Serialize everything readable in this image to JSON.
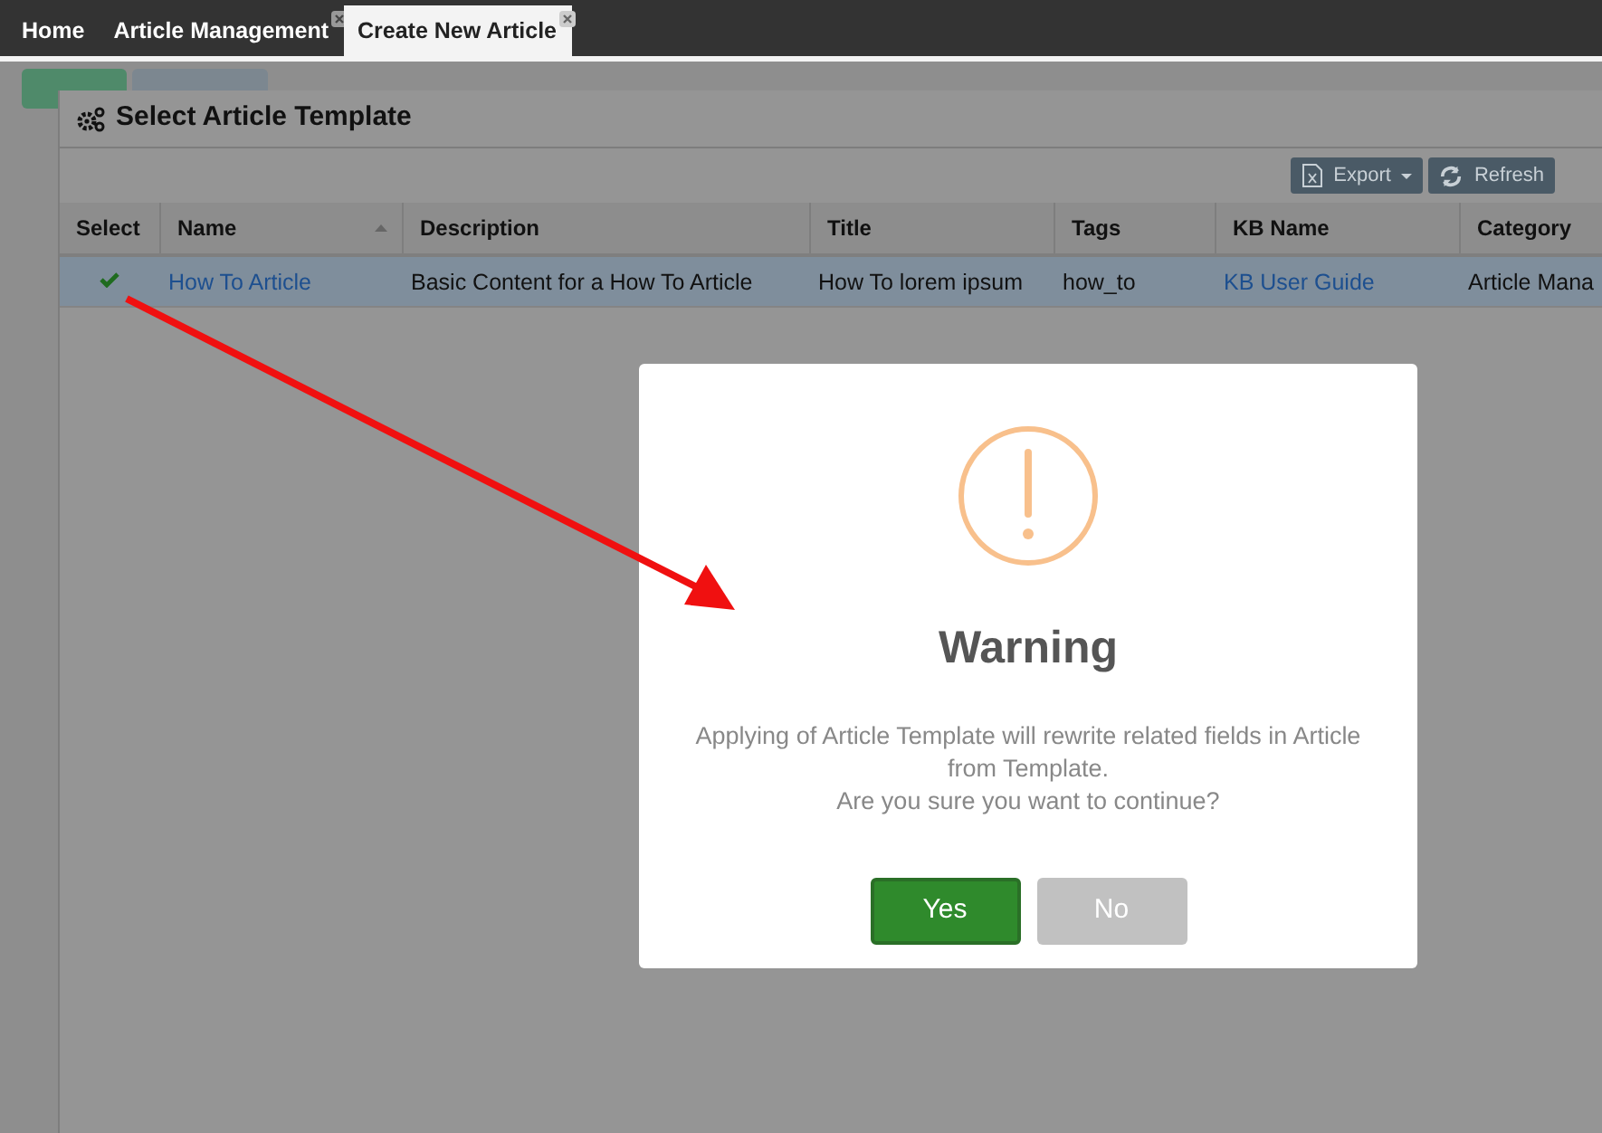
{
  "tabs": [
    {
      "label": "Home",
      "selected": false,
      "closable": false
    },
    {
      "label": "Article Management",
      "selected": false,
      "closable": true
    },
    {
      "label": "Create New Article",
      "selected": true,
      "closable": true
    }
  ],
  "dialog": {
    "title": "Select Article Template",
    "toolbar": [
      {
        "label": "Export",
        "kind": "export"
      },
      {
        "label": "Refresh",
        "kind": "refresh"
      }
    ],
    "table": {
      "columns": [
        {
          "label": "Select",
          "sorted": false
        },
        {
          "label": "Name",
          "sorted": true
        },
        {
          "label": "Description",
          "sorted": false
        },
        {
          "label": "Title",
          "sorted": false
        },
        {
          "label": "Tags",
          "sorted": false
        },
        {
          "label": "KB Name",
          "sorted": false
        },
        {
          "label": "Category",
          "sorted": false
        }
      ],
      "rows": [
        {
          "selected": true,
          "cells": [
            {
              "kind": "check",
              "checked": true
            },
            {
              "text": "How To Article",
              "kind": "link"
            },
            {
              "text": "Basic Content for a How To Article",
              "kind": "text"
            },
            {
              "text": "How To lorem ipsum",
              "kind": "text"
            },
            {
              "text": "how_to",
              "kind": "text"
            },
            {
              "text": "KB User Guide",
              "kind": "link"
            },
            {
              "text": "Article Mana",
              "kind": "text"
            }
          ]
        }
      ]
    }
  },
  "warning": {
    "title": "Warning",
    "message": [
      "Applying of Article Template will rewrite related fields in Article from Template.",
      "Are you sure you want to continue?"
    ],
    "buttons": [
      {
        "label": "Yes",
        "kind": "primary"
      },
      {
        "label": "No",
        "kind": "secondary"
      }
    ]
  }
}
